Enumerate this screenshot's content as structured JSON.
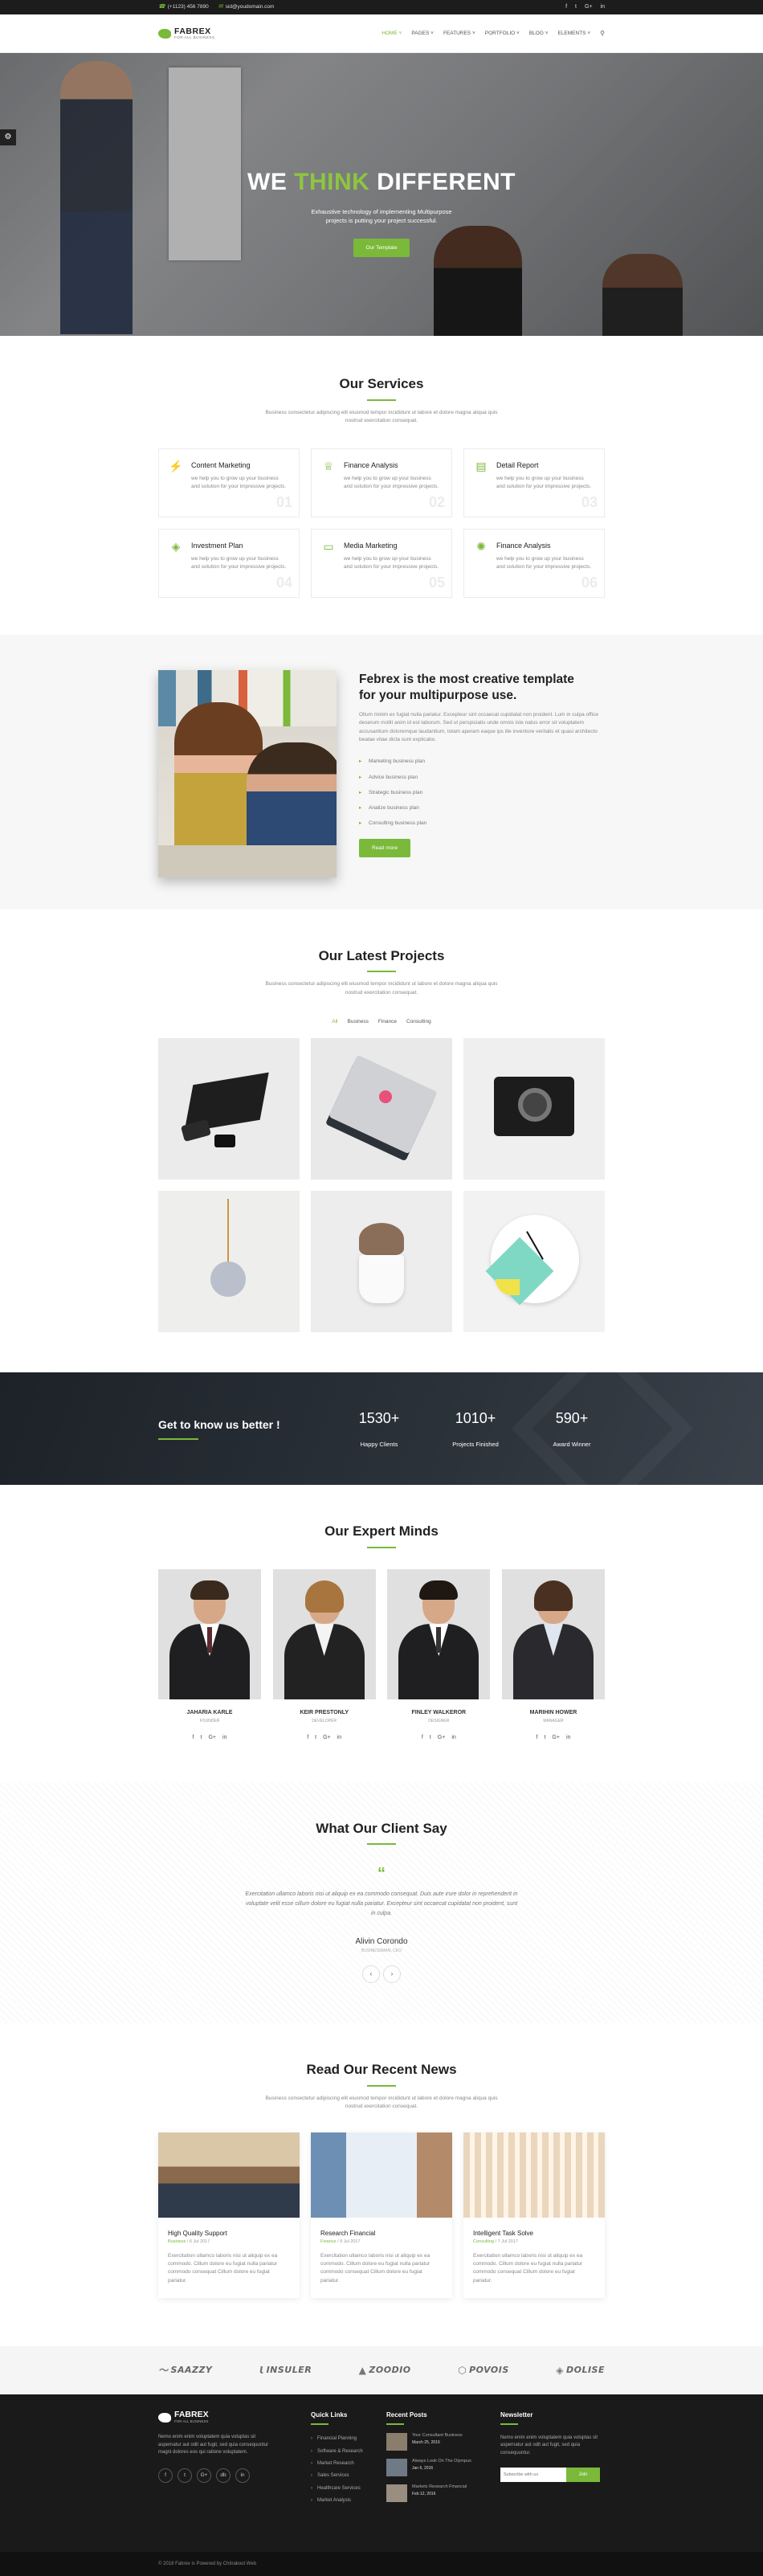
{
  "topbar": {
    "phone": "(+1123) 456 7890",
    "email": "sid@youdomain.com",
    "social": [
      "f",
      "t",
      "G+",
      "in"
    ]
  },
  "header": {
    "logo_name": "FABREX",
    "logo_tagline": "FOR ALL BUSINESS",
    "nav": [
      "HOME",
      "PAGES",
      "FEATURES",
      "PORTFOLIO",
      "BLOG",
      "ELEMENTS"
    ]
  },
  "hero": {
    "title_1": "WE",
    "title_highlight": "THINK",
    "title_2": "DIFFERENT",
    "subtitle": "Exhaustive technology of implementing Multipurpose projects is putting your project successful.",
    "button": "Our Template"
  },
  "services": {
    "title": "Our Services",
    "desc": "Business consectetur adipiscing elit eiusmod tempor incididunt ut labore et dolore magna aliqua quis nostrud exercitation consequat.",
    "items": [
      {
        "title": "Content Marketing",
        "text": "we help you to grow up your business and solution for your impressive projects.",
        "num": "01",
        "icon": "chart-icon"
      },
      {
        "title": "Finance Analysis",
        "text": "we help you to grow up your business and solution for your impressive projects.",
        "num": "02",
        "icon": "trophy-icon"
      },
      {
        "title": "Detail Report",
        "text": "we help you to grow up your business and solution for your impressive projects.",
        "num": "03",
        "icon": "document-icon"
      },
      {
        "title": "Investment Plan",
        "text": "we help you to grow up your business and solution for your impressive projects.",
        "num": "04",
        "icon": "layers-icon"
      },
      {
        "title": "Media Marketing",
        "text": "we help you to grow up your business and solution for your impressive projects.",
        "num": "05",
        "icon": "monitor-icon"
      },
      {
        "title": "Finance Analysis",
        "text": "we help you to grow up your business and solution for your impressive projects.",
        "num": "06",
        "icon": "gear-icon"
      }
    ]
  },
  "about": {
    "title": "Febrex is the most creative template for your multipurpose use.",
    "text": "Ollum minim ex fugiat nulla pariatur. Excepteur sint occaecat cupidatat non proident. Lum in culpa office deserum mollit anim id est laborum. Sed ut perspiciatis unde omnis iste natus error sit voluptatem accusantium doloremque laudantium, totam aperam eaque ips ille inventore veritatis et quasi architecto beatae vitae dicta sunt explicabo.",
    "list": [
      "Marketing business plan",
      "Advice business plan",
      "Strategic business plan",
      "Analize business plan",
      "Consulting business plan"
    ],
    "button": "Read more"
  },
  "projects": {
    "title": "Our Latest Projects",
    "desc": "Business consectetur adipiscing elit eiusmod tempor incididunt ut labore et dolore magna aliqua quis nostrud exercitation consequat.",
    "filters": [
      "All",
      "Business",
      "Finance",
      "Consulting"
    ]
  },
  "counter": {
    "title": "Get to know us better !",
    "items": [
      {
        "value": "1530+",
        "label": "Happy Clients"
      },
      {
        "value": "1010+",
        "label": "Projects Finished"
      },
      {
        "value": "590+",
        "label": "Award Winner"
      }
    ]
  },
  "team": {
    "title": "Our Expert Minds",
    "members": [
      {
        "name": "JAHARIA KARLE",
        "role": "FOUNDER",
        "gender": "m"
      },
      {
        "name": "KEIR PRESTONLY",
        "role": "DEVELOPER",
        "gender": "f"
      },
      {
        "name": "FINLEY WALKEROR",
        "role": "DESIGNER",
        "gender": "m"
      },
      {
        "name": "MARIHIN HOWER",
        "role": "MANAGER",
        "gender": "f"
      }
    ],
    "social": [
      "f",
      "t",
      "G+",
      "in"
    ]
  },
  "testimonials": {
    "title": "What Our Client Say",
    "text": "Exercitation ullamco laboris nisi ut aliquip ex ea commodo consequat. Duis aute irure dolor in reprehenderit in voluptate velit esse cillum dolore eu fugiat nulla pariatur. Excepteur sint occaecat cupidatat non proident, sunt in culpa.",
    "name": "Alivin Corondo",
    "role": "BUSINESSMAN, CEO"
  },
  "news": {
    "title": "Read Our Recent News",
    "desc": "Business consectetur adipiscing elit eiusmod tempor incididunt ut labore et dolore magna aliqua quis nostrud exercitation consequat.",
    "items": [
      {
        "title": "High Quality Support",
        "category": "Business",
        "date": "6 Jul 2017",
        "text": "Exercitation ullamco laboris nisi ut aliquip ex ea commodo. Cillum dolore eu fugiat nulla pariatur commodo consequat Cillum dolore eu fugiat pariatur."
      },
      {
        "title": "Research Financial",
        "category": "Finance",
        "date": "9 Jul 2017",
        "text": "Exercitation ullamco laboris nisi ut aliquip ex ea commodo. Cillum dolore eu fugiat nulla pariatur commodo consequat Cillum dolore eu fugiat pariatur."
      },
      {
        "title": "Intelligent Task Solve",
        "category": "Consulting",
        "date": "7 Jul 2017",
        "text": "Exercitation ullamco laboris nisi ut aliquip ex ea commodo. Cillum dolore eu fugiat nulla pariatur commodo consequat Cillum dolore eu fugiat pariatur."
      }
    ]
  },
  "partners": [
    "SAAZZY",
    "INSULER",
    "ZOODIO",
    "POVOIS",
    "DOLISE"
  ],
  "footer": {
    "logo_name": "FABREX",
    "logo_tagline": "FOR ALL BUSINESS",
    "about": "Nemo enim enim voluptatem quia voluptas sit aspernatur aut odit aut fugit, sed quia consequuntur magni dolores eos qui ratione voluptatem.",
    "social": [
      "f",
      "t",
      "G+",
      "db",
      "in"
    ],
    "links_title": "Quick Links",
    "links": [
      "Financial Planning",
      "Software & Research",
      "Market Research",
      "Sales Services",
      "Healthcare Services",
      "Market Analysis"
    ],
    "posts_title": "Recent Posts",
    "posts": [
      {
        "title": "Your Consultant Business",
        "date": "March 25, 2016"
      },
      {
        "title": "Always Look On The Olympus",
        "date": "Jan 6, 2016"
      },
      {
        "title": "Markets Research Financial",
        "date": "Feb 12, 2016"
      }
    ],
    "newsletter_title": "Newsletter",
    "newsletter_text": "Nemo enim enim voluptatem quia voluptas sit aspernatur aut odit aut fugit, sed quia consequuntur.",
    "newsletter_placeholder": "Subscribe with us",
    "newsletter_button": "Join",
    "copyright": "© 2018 Fabrex is Powered by Chitrakoot Web"
  },
  "colors": {
    "accent": "#7ab93a",
    "dark": "#1a1a1a"
  }
}
